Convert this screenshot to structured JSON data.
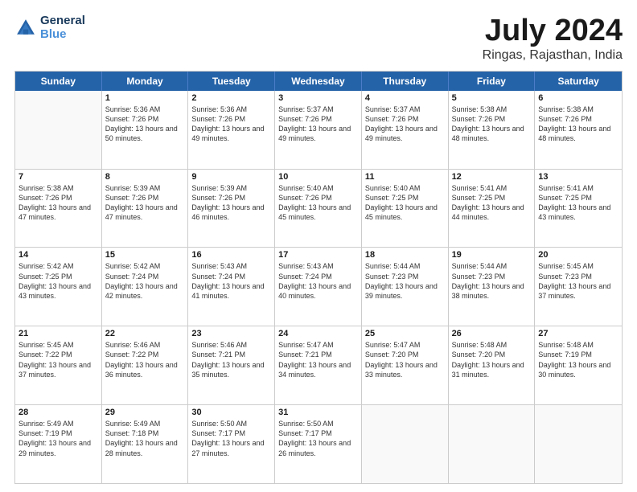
{
  "header": {
    "logo_line1": "General",
    "logo_line2": "Blue",
    "title": "July 2024",
    "location": "Ringas, Rajasthan, India"
  },
  "weekdays": [
    "Sunday",
    "Monday",
    "Tuesday",
    "Wednesday",
    "Thursday",
    "Friday",
    "Saturday"
  ],
  "rows": [
    [
      {
        "day": "",
        "empty": true
      },
      {
        "day": "1",
        "sunrise": "5:36 AM",
        "sunset": "7:26 PM",
        "daylight": "13 hours and 50 minutes."
      },
      {
        "day": "2",
        "sunrise": "5:36 AM",
        "sunset": "7:26 PM",
        "daylight": "13 hours and 49 minutes."
      },
      {
        "day": "3",
        "sunrise": "5:37 AM",
        "sunset": "7:26 PM",
        "daylight": "13 hours and 49 minutes."
      },
      {
        "day": "4",
        "sunrise": "5:37 AM",
        "sunset": "7:26 PM",
        "daylight": "13 hours and 49 minutes."
      },
      {
        "day": "5",
        "sunrise": "5:38 AM",
        "sunset": "7:26 PM",
        "daylight": "13 hours and 48 minutes."
      },
      {
        "day": "6",
        "sunrise": "5:38 AM",
        "sunset": "7:26 PM",
        "daylight": "13 hours and 48 minutes."
      }
    ],
    [
      {
        "day": "7",
        "sunrise": "5:38 AM",
        "sunset": "7:26 PM",
        "daylight": "13 hours and 47 minutes."
      },
      {
        "day": "8",
        "sunrise": "5:39 AM",
        "sunset": "7:26 PM",
        "daylight": "13 hours and 47 minutes."
      },
      {
        "day": "9",
        "sunrise": "5:39 AM",
        "sunset": "7:26 PM",
        "daylight": "13 hours and 46 minutes."
      },
      {
        "day": "10",
        "sunrise": "5:40 AM",
        "sunset": "7:26 PM",
        "daylight": "13 hours and 45 minutes."
      },
      {
        "day": "11",
        "sunrise": "5:40 AM",
        "sunset": "7:25 PM",
        "daylight": "13 hours and 45 minutes."
      },
      {
        "day": "12",
        "sunrise": "5:41 AM",
        "sunset": "7:25 PM",
        "daylight": "13 hours and 44 minutes."
      },
      {
        "day": "13",
        "sunrise": "5:41 AM",
        "sunset": "7:25 PM",
        "daylight": "13 hours and 43 minutes."
      }
    ],
    [
      {
        "day": "14",
        "sunrise": "5:42 AM",
        "sunset": "7:25 PM",
        "daylight": "13 hours and 43 minutes."
      },
      {
        "day": "15",
        "sunrise": "5:42 AM",
        "sunset": "7:24 PM",
        "daylight": "13 hours and 42 minutes."
      },
      {
        "day": "16",
        "sunrise": "5:43 AM",
        "sunset": "7:24 PM",
        "daylight": "13 hours and 41 minutes."
      },
      {
        "day": "17",
        "sunrise": "5:43 AM",
        "sunset": "7:24 PM",
        "daylight": "13 hours and 40 minutes."
      },
      {
        "day": "18",
        "sunrise": "5:44 AM",
        "sunset": "7:23 PM",
        "daylight": "13 hours and 39 minutes."
      },
      {
        "day": "19",
        "sunrise": "5:44 AM",
        "sunset": "7:23 PM",
        "daylight": "13 hours and 38 minutes."
      },
      {
        "day": "20",
        "sunrise": "5:45 AM",
        "sunset": "7:23 PM",
        "daylight": "13 hours and 37 minutes."
      }
    ],
    [
      {
        "day": "21",
        "sunrise": "5:45 AM",
        "sunset": "7:22 PM",
        "daylight": "13 hours and 37 minutes."
      },
      {
        "day": "22",
        "sunrise": "5:46 AM",
        "sunset": "7:22 PM",
        "daylight": "13 hours and 36 minutes."
      },
      {
        "day": "23",
        "sunrise": "5:46 AM",
        "sunset": "7:21 PM",
        "daylight": "13 hours and 35 minutes."
      },
      {
        "day": "24",
        "sunrise": "5:47 AM",
        "sunset": "7:21 PM",
        "daylight": "13 hours and 34 minutes."
      },
      {
        "day": "25",
        "sunrise": "5:47 AM",
        "sunset": "7:20 PM",
        "daylight": "13 hours and 33 minutes."
      },
      {
        "day": "26",
        "sunrise": "5:48 AM",
        "sunset": "7:20 PM",
        "daylight": "13 hours and 31 minutes."
      },
      {
        "day": "27",
        "sunrise": "5:48 AM",
        "sunset": "7:19 PM",
        "daylight": "13 hours and 30 minutes."
      }
    ],
    [
      {
        "day": "28",
        "sunrise": "5:49 AM",
        "sunset": "7:19 PM",
        "daylight": "13 hours and 29 minutes."
      },
      {
        "day": "29",
        "sunrise": "5:49 AM",
        "sunset": "7:18 PM",
        "daylight": "13 hours and 28 minutes."
      },
      {
        "day": "30",
        "sunrise": "5:50 AM",
        "sunset": "7:17 PM",
        "daylight": "13 hours and 27 minutes."
      },
      {
        "day": "31",
        "sunrise": "5:50 AM",
        "sunset": "7:17 PM",
        "daylight": "13 hours and 26 minutes."
      },
      {
        "day": "",
        "empty": true
      },
      {
        "day": "",
        "empty": true
      },
      {
        "day": "",
        "empty": true
      }
    ]
  ]
}
